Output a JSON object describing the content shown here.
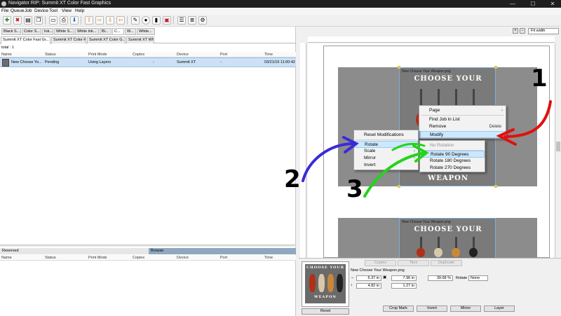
{
  "window": {
    "title": "Navigator RIP: Summit XT Color Fast Graphics",
    "minimize": "—",
    "maximize": "☐",
    "close": "✕"
  },
  "menu": [
    "File",
    "Queue",
    "Job",
    "Device",
    "Tool",
    "View",
    "Help"
  ],
  "filter_tabs": [
    "Black S...",
    "Color S...",
    "Ink...",
    "White S...",
    "White Ink...",
    "Bl...",
    "C...",
    "W...",
    "White..."
  ],
  "printer_tabs": [
    "Summit XT Color Fast Gr...",
    "Summit XT Color Fast G...",
    "Summit XT Color G...",
    "Summit XT White..."
  ],
  "total_label": "total : 1",
  "columns": [
    "Name",
    "Status",
    "Print Mode",
    "Copies",
    "Device",
    "Port",
    "Time"
  ],
  "job": {
    "name": "New Choose Yo...",
    "status": "Pending",
    "print_mode": "Using Layers",
    "copies": "-",
    "device": "Summit XT",
    "port": "-",
    "time": "03/21/15 11:00:42"
  },
  "bottom_tabs": [
    "Reserved",
    "Browse"
  ],
  "preview": {
    "zoom": "Fit width",
    "poster_filename": "New Choose Your Weapon.png",
    "poster_title": "CHOOSE YOUR",
    "poster_bottom": "WEAPON"
  },
  "context_menu_main": [
    {
      "label": "Page",
      "submenu": true
    },
    {
      "label": "Find Job in List"
    },
    {
      "label": "Remove",
      "shortcut": "Delete"
    },
    {
      "label": "Modify",
      "submenu": true,
      "highlighted": true
    }
  ],
  "context_menu_modify": [
    {
      "label": "Reset Modifications"
    },
    {
      "label": "Rotate",
      "submenu": true,
      "highlighted": true
    },
    {
      "label": "Scale",
      "submenu": true
    },
    {
      "label": "Mirror",
      "submenu": true
    },
    {
      "label": "Invert"
    }
  ],
  "context_menu_rotate": [
    {
      "label": "No Rotation",
      "disabled": true
    },
    {
      "label": "Rotate 90 Degrees",
      "highlighted": true
    },
    {
      "label": "Rotate 180 Degrees"
    },
    {
      "label": "Rotate 270 Degrees"
    }
  ],
  "annotations": [
    "1",
    "2",
    "3"
  ],
  "annotation_colors": {
    "1": "#e01010",
    "2": "#3a2ad8",
    "3": "#22d41a"
  },
  "properties": {
    "tabs": [
      "Copies",
      "Tiles",
      "Duplicate"
    ],
    "filename": "New Choose Your Weapon.png",
    "x": "6.37 in",
    "width": "7.96 in",
    "scale": "39.68 %",
    "rotate_label": "Rotate",
    "rotate_value": "None",
    "y": "4.82 in",
    "height": "1.27 in",
    "thumb_title": "CHOOSE YOUR",
    "thumb_bottom": "WEAPON",
    "buttons": [
      "Reset",
      "Crop Mark",
      "Invert",
      "Mirror",
      "Layer"
    ]
  }
}
